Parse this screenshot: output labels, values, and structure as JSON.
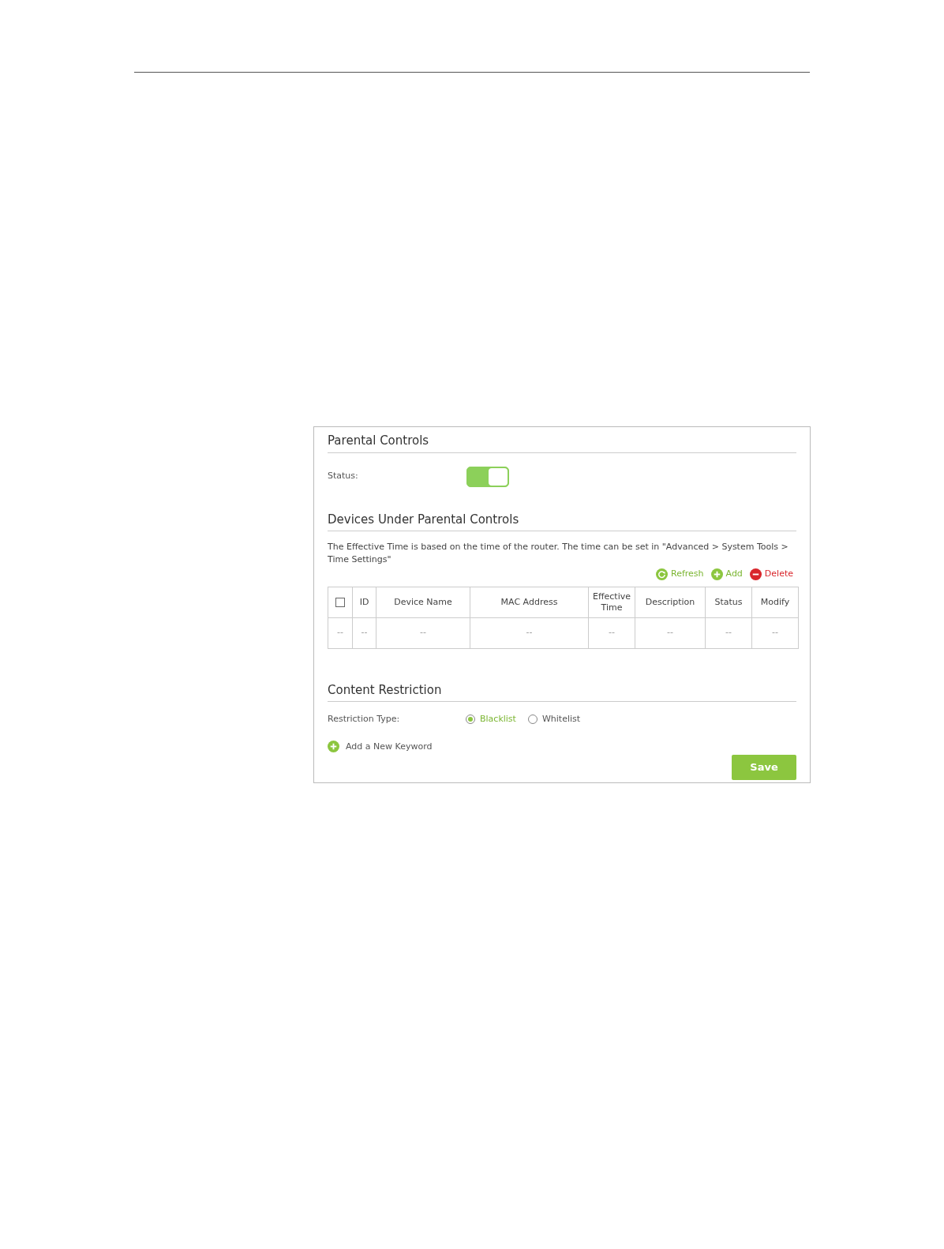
{
  "parental_controls": {
    "title": "Parental Controls",
    "status_label": "Status:",
    "status_on": true
  },
  "devices": {
    "title": "Devices Under Parental Controls",
    "note": "The Effective Time is based on the time of the router. The time can be set in \"Advanced > System Tools > Time Settings\"",
    "actions": [
      {
        "kind": "refresh",
        "label": "Refresh"
      },
      {
        "kind": "add",
        "label": "Add"
      },
      {
        "kind": "delete",
        "label": "Delete"
      }
    ],
    "table": {
      "select_all_checked": false,
      "columns": [
        "ID",
        "Device Name",
        "MAC Address",
        "Effective Time",
        "Description",
        "Status",
        "Modify"
      ],
      "rows": [
        {
          "checkbox_cell": "--",
          "cells": [
            "--",
            "--",
            "--",
            "--",
            "--",
            "--",
            "--"
          ]
        }
      ]
    }
  },
  "content_restriction": {
    "title": "Content Restriction",
    "type_label": "Restriction Type:",
    "options": [
      {
        "label": "Blacklist",
        "selected": true
      },
      {
        "label": "Whitelist",
        "selected": false
      }
    ],
    "add_keyword": "Add a New Keyword"
  },
  "save_button": "Save"
}
